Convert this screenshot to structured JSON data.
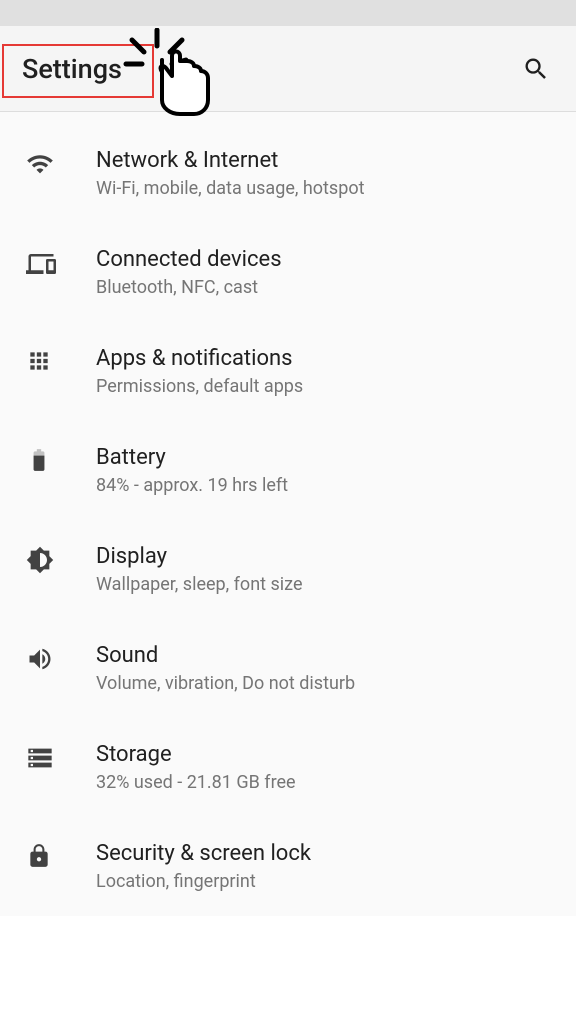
{
  "header": {
    "title": "Settings"
  },
  "items": [
    {
      "icon": "wifi-icon",
      "title": "Network & Internet",
      "subtitle": "Wi-Fi, mobile, data usage, hotspot"
    },
    {
      "icon": "devices-icon",
      "title": "Connected devices",
      "subtitle": "Bluetooth, NFC, cast"
    },
    {
      "icon": "apps-icon",
      "title": "Apps & notifications",
      "subtitle": "Permissions, default apps"
    },
    {
      "icon": "battery-icon",
      "title": "Battery",
      "subtitle": "84% - approx. 19 hrs left"
    },
    {
      "icon": "display-icon",
      "title": "Display",
      "subtitle": "Wallpaper, sleep, font size"
    },
    {
      "icon": "sound-icon",
      "title": "Sound",
      "subtitle": "Volume, vibration, Do not disturb"
    },
    {
      "icon": "storage-icon",
      "title": "Storage",
      "subtitle": "32% used - 21.81 GB free"
    },
    {
      "icon": "security-icon",
      "title": "Security & screen lock",
      "subtitle": "Location, fingerprint"
    }
  ]
}
